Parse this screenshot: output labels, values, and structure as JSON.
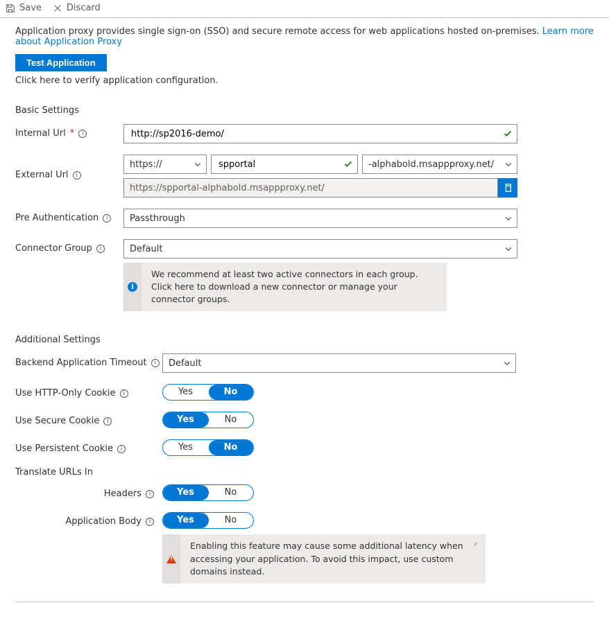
{
  "commands": {
    "save": "Save",
    "discard": "Discard"
  },
  "intro": {
    "text": "Application proxy provides single sign-on (SSO) and secure remote access for web applications hosted on-premises. ",
    "link": "Learn more about Application Proxy"
  },
  "test_btn": "Test Application",
  "test_hint": "Click here to verify application configuration.",
  "sections": {
    "basic": "Basic Settings",
    "additional": "Additional Settings"
  },
  "labels": {
    "internal_url": "Internal Url",
    "external_url": "External Url",
    "pre_auth": "Pre Authentication",
    "connector_group": "Connector Group",
    "backend_timeout": "Backend Application Timeout",
    "http_only": "Use HTTP-Only Cookie",
    "secure_cookie": "Use Secure Cookie",
    "persistent_cookie": "Use Persistent Cookie",
    "translate_urls": "Translate URLs In",
    "headers": "Headers",
    "app_body": "Application Body"
  },
  "values": {
    "internal_url": "http://sp2016-demo/",
    "external_scheme": "https://",
    "external_host": "spportal",
    "external_domain": "-alphabold.msappproxy.net/",
    "external_full": "https://spportal-alphabold.msappproxy.net/",
    "pre_auth": "Passthrough",
    "connector_group": "Default",
    "backend_timeout": "Default"
  },
  "toggles": {
    "yes": "Yes",
    "no": "No",
    "http_only": "no",
    "secure_cookie": "yes",
    "persistent_cookie": "no",
    "headers": "yes",
    "app_body": "yes"
  },
  "callouts": {
    "connector": "We recommend at least two active connectors in each group. Click here to download a new connector or manage your connector groups.",
    "translate_warn": "Enabling this feature may cause some additional latency when accessing your application. To avoid this impact, use custom domains instead."
  }
}
